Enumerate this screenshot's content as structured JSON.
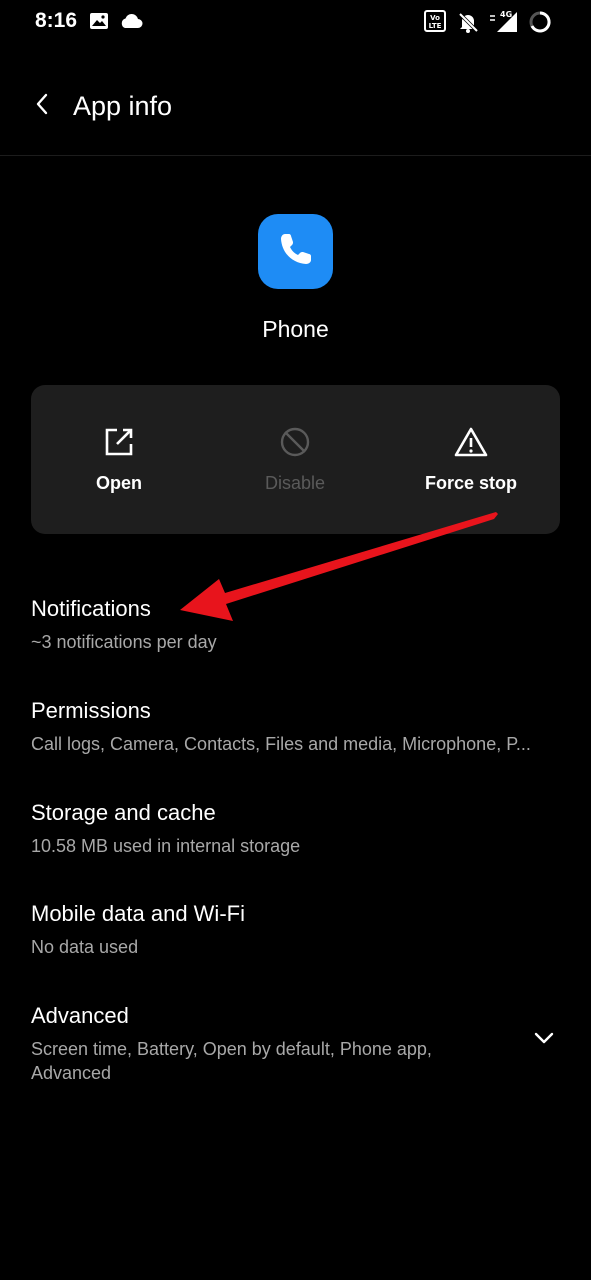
{
  "status_bar": {
    "time": "8:16",
    "icons": [
      "gallery-icon",
      "cloud-icon",
      "volte-icon",
      "mute-bell-icon",
      "signal-4g-icon",
      "battery-ring-icon"
    ],
    "network_label": "4G"
  },
  "header": {
    "back_icon": "chevron-left-icon",
    "title": "App info"
  },
  "app": {
    "name": "Phone",
    "icon": "phone-handset-icon",
    "icon_color": "#1e8cf5"
  },
  "actions": [
    {
      "label": "Open",
      "icon": "open-external-icon",
      "enabled": true
    },
    {
      "label": "Disable",
      "icon": "disable-circle-icon",
      "enabled": false
    },
    {
      "label": "Force stop",
      "icon": "warning-triangle-icon",
      "enabled": true
    }
  ],
  "settings": [
    {
      "title": "Notifications",
      "summary": "~3 notifications per day"
    },
    {
      "title": "Permissions",
      "summary": "Call logs, Camera, Contacts, Files and media, Microphone, P..."
    },
    {
      "title": "Storage and cache",
      "summary": "10.58 MB used in internal storage"
    },
    {
      "title": "Mobile data and Wi-Fi",
      "summary": "No data used"
    },
    {
      "title": "Advanced",
      "summary": "Screen time, Battery, Open by default, Phone app, Advanced",
      "expand_icon": "chevron-down-icon"
    }
  ],
  "annotation": {
    "type": "red-arrow",
    "color": "#e8141c"
  },
  "colors": {
    "background": "#000000",
    "card": "#1e1e1e",
    "text_primary": "#ffffff",
    "text_secondary": "#a8a8a8",
    "text_disabled": "#5a5a5a"
  }
}
